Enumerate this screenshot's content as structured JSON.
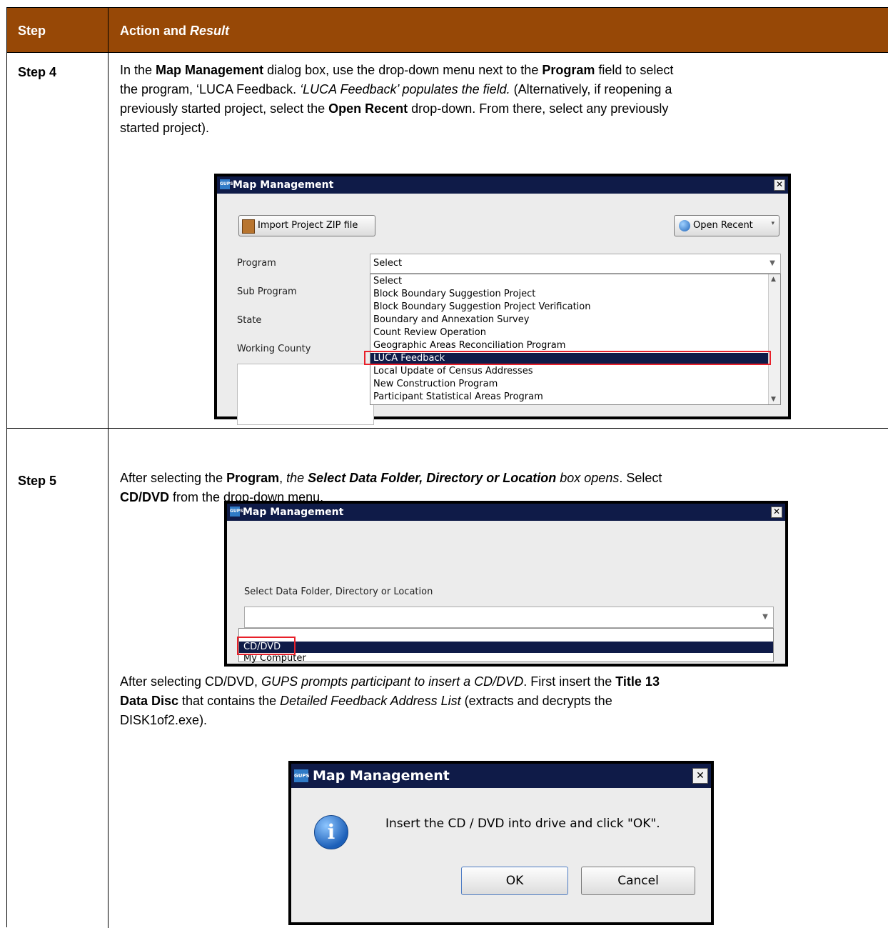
{
  "header": {
    "step": "Step",
    "action": "Action and",
    "result": "Result"
  },
  "step4": {
    "label": "Step 4",
    "p": [
      "In the ",
      "Map Management",
      " dialog box, use the drop-down menu next to the ",
      "Program",
      " field to select",
      "the program, ‘LUCA Feedback. ",
      "‘LUCA Feedback’ populates the field.",
      " (Alternatively, if reopening a",
      "previously started project, select the ",
      "Open Recent",
      " drop-down. From there, select any previously",
      "started project)."
    ],
    "dialog": {
      "title": "Map Management",
      "close": "✕",
      "import_btn": "Import Project ZIP file",
      "open_recent_btn": "Open Recent",
      "labels": [
        "Program",
        "Sub Program",
        "State",
        "Working County"
      ],
      "program_value": "Select",
      "options": [
        "Select",
        "Block Boundary Suggestion Project",
        "Block Boundary Suggestion Project Verification",
        "Boundary and Annexation Survey",
        "Count Review Operation",
        "Geographic Areas Reconciliation Program",
        "LUCA Feedback",
        "Local Update of Census Addresses",
        "New Construction Program",
        "Participant Statistical Areas Program"
      ],
      "selected": "LUCA Feedback"
    }
  },
  "step5": {
    "label": "Step 5",
    "p1": [
      "After selecting the ",
      "Program",
      ", ",
      "the ",
      "Select Data Folder, Directory or Location",
      " box opens",
      ". Select"
    ],
    "p1b": [
      "CD/DVD",
      " from the drop-down menu."
    ],
    "dialog1": {
      "title": "Map Management",
      "close": "✕",
      "label": "Select Data Folder, Directory or Location",
      "options": [
        "CD/DVD",
        "My Computer"
      ],
      "selected": "CD/DVD"
    },
    "p2": [
      "After selecting CD/DVD, ",
      "GUPS prompts participant to insert a CD/DVD",
      ". First insert the ",
      "Title 13",
      "Data Disc",
      " that contains the ",
      "Detailed Feedback Address List",
      " (extracts and decrypts the",
      "DISK1of2.exe)."
    ],
    "dialog2": {
      "title": "Map Management",
      "close": "✕",
      "message": "Insert the CD / DVD into drive and click \"OK\".",
      "ok": "OK",
      "cancel": "Cancel"
    }
  }
}
